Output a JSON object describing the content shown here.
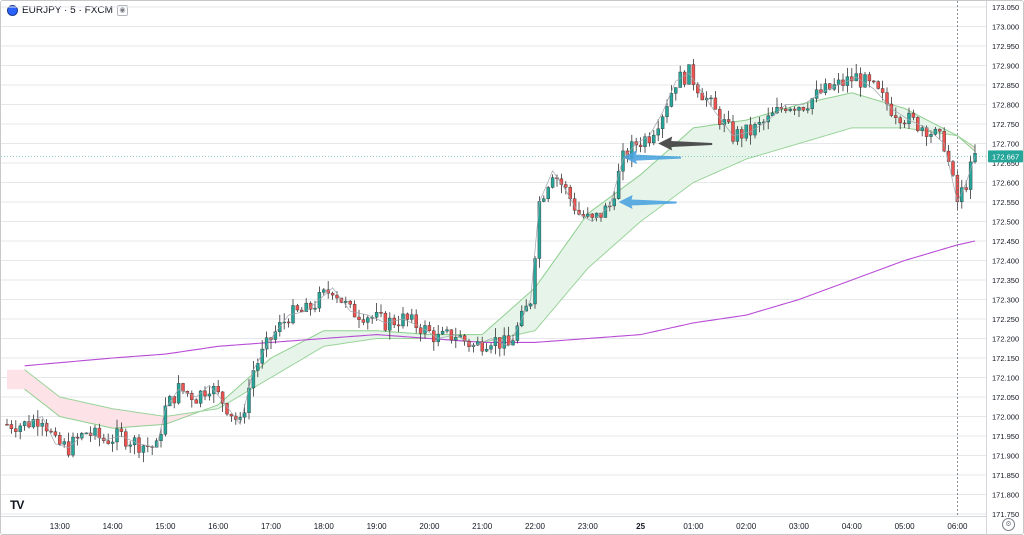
{
  "header": {
    "symbol_label": "EURJPY · 5 · FXCM",
    "symbol_icon": "circle-flag-icon"
  },
  "price_axis": {
    "labels": [
      "173.050",
      "173.000",
      "172.950",
      "172.900",
      "172.850",
      "172.800",
      "172.750",
      "172.700",
      "172.650",
      "172.600",
      "172.550",
      "172.500",
      "172.450",
      "172.400",
      "172.350",
      "172.300",
      "172.250",
      "172.200",
      "172.150",
      "172.100",
      "172.050",
      "172.000",
      "171.950",
      "171.900",
      "171.850",
      "171.800",
      "171.750"
    ],
    "current_price": "172.667",
    "current_price_color": "#26a69a"
  },
  "time_axis": {
    "labels": [
      "13:00",
      "14:00",
      "15:00",
      "16:00",
      "17:00",
      "18:00",
      "19:00",
      "20:00",
      "21:00",
      "22:00",
      "23:00",
      "25",
      "01:00",
      "02:00",
      "03:00",
      "04:00",
      "05:00",
      "06:00"
    ]
  },
  "chart_data": {
    "type": "candlestick",
    "symbol": "EURJPY",
    "timeframe": "5",
    "source": "FXCM",
    "ylim": [
      171.75,
      173.05
    ],
    "colors": {
      "up": "#26a69a",
      "down": "#ef5350",
      "ema_fast_band": "#e8f5e9",
      "bear_band": "#fde4ea",
      "ema_slow": "#b94cd6"
    },
    "price_path": [
      [
        "12:20",
        171.98
      ],
      [
        "12:40",
        172.0
      ],
      [
        "12:55",
        171.93
      ],
      [
        "13:10",
        171.92
      ],
      [
        "13:30",
        171.96
      ],
      [
        "13:50",
        171.94
      ],
      [
        "14:10",
        171.95
      ],
      [
        "14:30",
        171.93
      ],
      [
        "14:50",
        171.92
      ],
      [
        "15:00",
        172.02
      ],
      [
        "15:15",
        172.07
      ],
      [
        "15:35",
        172.05
      ],
      [
        "15:50",
        172.08
      ],
      [
        "16:05",
        172.04
      ],
      [
        "16:25",
        171.98
      ],
      [
        "16:40",
        172.12
      ],
      [
        "17:00",
        172.2
      ],
      [
        "17:20",
        172.26
      ],
      [
        "17:40",
        172.27
      ],
      [
        "17:55",
        172.3
      ],
      [
        "18:10",
        172.33
      ],
      [
        "18:30",
        172.27
      ],
      [
        "18:50",
        172.26
      ],
      [
        "19:10",
        172.24
      ],
      [
        "19:30",
        172.25
      ],
      [
        "19:50",
        172.23
      ],
      [
        "20:10",
        172.2
      ],
      [
        "20:30",
        172.21
      ],
      [
        "20:50",
        172.18
      ],
      [
        "21:10",
        172.2
      ],
      [
        "21:30",
        172.18
      ],
      [
        "21:45",
        172.25
      ],
      [
        "21:55",
        172.3
      ],
      [
        "22:05",
        172.55
      ],
      [
        "22:20",
        172.63
      ],
      [
        "22:35",
        172.58
      ],
      [
        "22:50",
        172.52
      ],
      [
        "23:05",
        172.5
      ],
      [
        "23:25",
        172.54
      ],
      [
        "23:40",
        172.66
      ],
      [
        "23:55",
        172.7
      ],
      [
        "00:10",
        172.72
      ],
      [
        "00:25",
        172.78
      ],
      [
        "00:40",
        172.86
      ],
      [
        "00:55",
        172.88
      ],
      [
        "01:10",
        172.83
      ],
      [
        "01:25",
        172.78
      ],
      [
        "01:45",
        172.72
      ],
      [
        "02:05",
        172.73
      ],
      [
        "02:25",
        172.76
      ],
      [
        "02:45",
        172.8
      ],
      [
        "03:05",
        172.8
      ],
      [
        "03:25",
        172.83
      ],
      [
        "03:45",
        172.85
      ],
      [
        "04:05",
        172.87
      ],
      [
        "04:25",
        172.84
      ],
      [
        "04:45",
        172.79
      ],
      [
        "05:05",
        172.76
      ],
      [
        "05:25",
        172.74
      ],
      [
        "05:45",
        172.7
      ],
      [
        "06:00",
        172.55
      ],
      [
        "06:10",
        172.6
      ],
      [
        "06:20",
        172.667
      ]
    ],
    "ema_fast": [
      [
        "12:20",
        172.07
      ],
      [
        "13:00",
        172.0
      ],
      [
        "14:00",
        171.97
      ],
      [
        "15:00",
        171.98
      ],
      [
        "16:00",
        172.03
      ],
      [
        "17:00",
        172.15
      ],
      [
        "18:00",
        172.22
      ],
      [
        "19:00",
        172.22
      ],
      [
        "20:00",
        172.21
      ],
      [
        "21:00",
        172.21
      ],
      [
        "22:00",
        172.33
      ],
      [
        "23:00",
        172.52
      ],
      [
        "00:00",
        172.62
      ],
      [
        "01:00",
        172.74
      ],
      [
        "02:00",
        172.76
      ],
      [
        "03:00",
        172.8
      ],
      [
        "04:00",
        172.83
      ],
      [
        "05:00",
        172.79
      ],
      [
        "06:00",
        172.72
      ],
      [
        "06:20",
        172.68
      ]
    ],
    "ema_mid": [
      [
        "12:20",
        172.12
      ],
      [
        "13:00",
        172.05
      ],
      [
        "14:00",
        172.02
      ],
      [
        "15:00",
        172.0
      ],
      [
        "16:00",
        172.02
      ],
      [
        "17:00",
        172.1
      ],
      [
        "18:00",
        172.18
      ],
      [
        "19:00",
        172.2
      ],
      [
        "20:00",
        172.2
      ],
      [
        "21:00",
        172.19
      ],
      [
        "22:00",
        172.22
      ],
      [
        "23:00",
        172.38
      ],
      [
        "00:00",
        172.5
      ],
      [
        "01:00",
        172.6
      ],
      [
        "02:00",
        172.66
      ],
      [
        "03:00",
        172.7
      ],
      [
        "04:00",
        172.74
      ],
      [
        "05:00",
        172.74
      ],
      [
        "06:00",
        172.72
      ],
      [
        "06:20",
        172.69
      ]
    ],
    "ema_slow": [
      [
        "12:20",
        172.13
      ],
      [
        "14:00",
        172.15
      ],
      [
        "15:00",
        172.16
      ],
      [
        "16:00",
        172.18
      ],
      [
        "17:00",
        172.19
      ],
      [
        "18:00",
        172.2
      ],
      [
        "19:00",
        172.21
      ],
      [
        "20:00",
        172.2
      ],
      [
        "21:00",
        172.19
      ],
      [
        "22:00",
        172.19
      ],
      [
        "23:00",
        172.2
      ],
      [
        "00:00",
        172.21
      ],
      [
        "01:00",
        172.24
      ],
      [
        "02:00",
        172.26
      ],
      [
        "03:00",
        172.3
      ],
      [
        "04:00",
        172.35
      ],
      [
        "05:00",
        172.4
      ],
      [
        "06:00",
        172.44
      ],
      [
        "06:20",
        172.45
      ]
    ],
    "annotations": [
      {
        "type": "arrow",
        "color": "#3d3d3d",
        "price": 172.7,
        "time": "00:20"
      },
      {
        "type": "arrow",
        "color": "#4da3e0",
        "price": 172.665,
        "time": "23:40"
      },
      {
        "type": "arrow",
        "color": "#4da3e0",
        "price": 172.55,
        "time": "23:35"
      }
    ],
    "crosshair_time": "06:00"
  }
}
